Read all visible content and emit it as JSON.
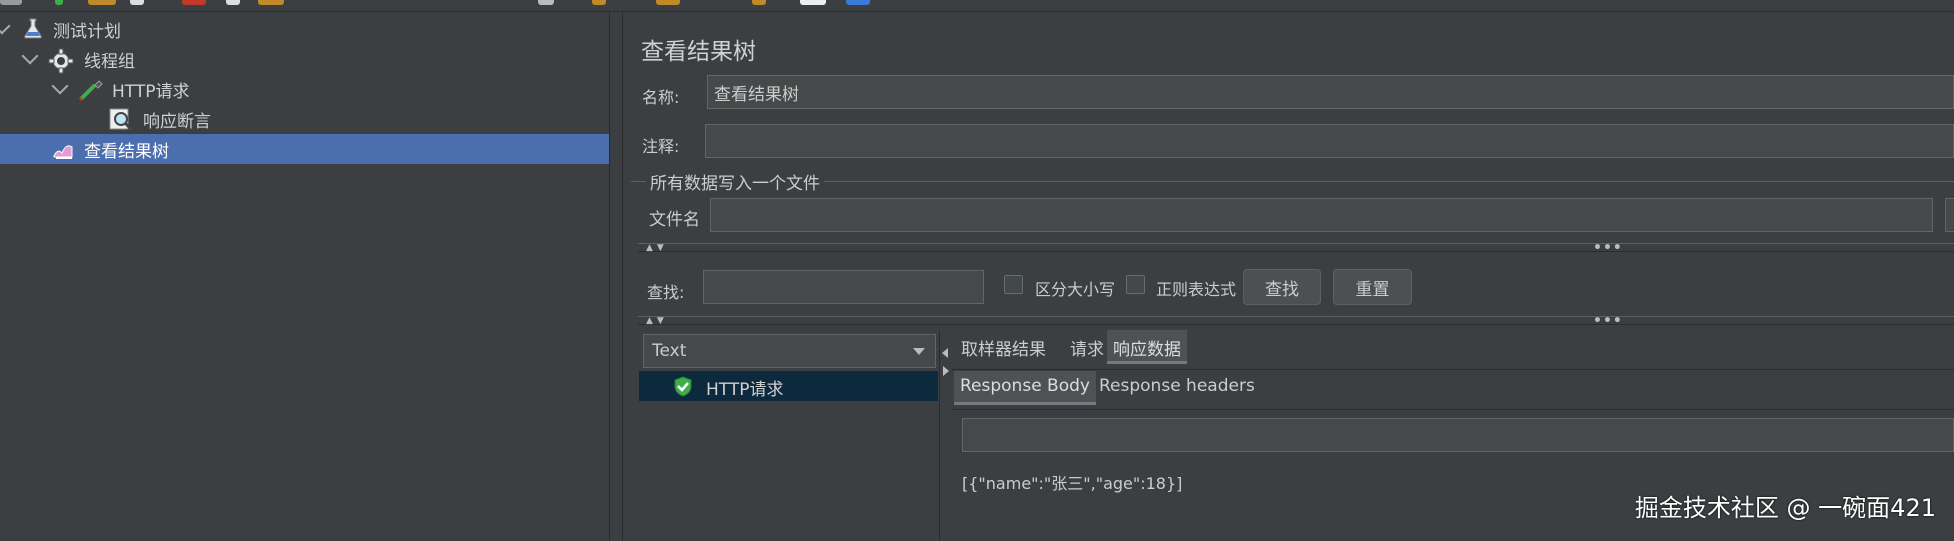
{
  "tree": {
    "items": [
      {
        "label": "测试计划"
      },
      {
        "label": "线程组"
      },
      {
        "label": "HTTP请求"
      },
      {
        "label": "响应断言"
      },
      {
        "label": "查看结果树"
      }
    ]
  },
  "panel": {
    "title": "查看结果树",
    "name_label": "名称:",
    "name_value": "查看结果树",
    "comment_label": "注释:",
    "comment_value": "",
    "file_group_title": "所有数据写入一个文件",
    "filename_label": "文件名",
    "filename_value": ""
  },
  "search": {
    "label": "查找:",
    "value": "",
    "case_sensitive_label": "区分大小写",
    "regex_label": "正则表达式",
    "find_button": "查找",
    "reset_button": "重置"
  },
  "results": {
    "renderer_selected": "Text",
    "items": [
      {
        "label": "HTTP请求",
        "status": "success"
      }
    ]
  },
  "detail_tabs": {
    "main": [
      "取样器结果",
      "请求",
      "响应数据"
    ],
    "active_main": "响应数据",
    "sub": [
      "Response Body",
      "Response headers"
    ],
    "active_sub": "Response Body",
    "response_body": "[{\"name\":\"张三\",\"age\":18}]"
  },
  "watermark": "掘金技术社区 @ 一碗面421",
  "colors": {
    "background": "#3c3f41",
    "selection": "#4b6eaf",
    "result_selection": "#0d293e",
    "success": "#3fae49"
  }
}
